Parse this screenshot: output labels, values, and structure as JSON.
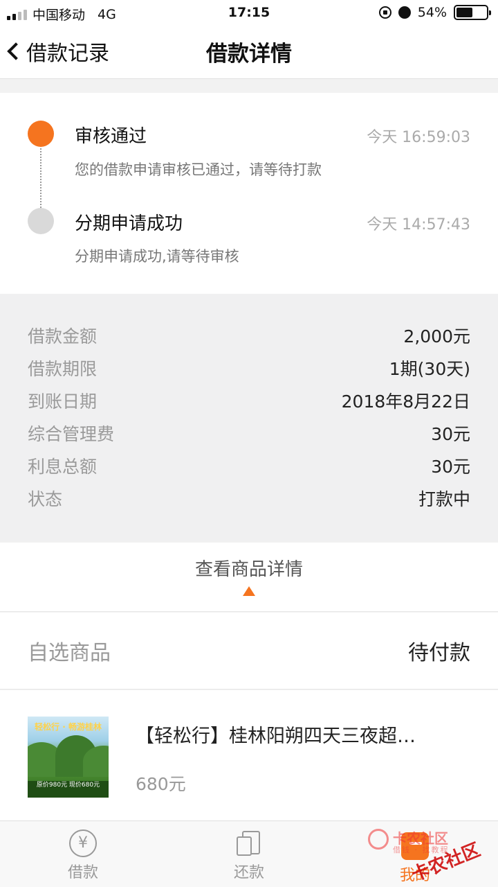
{
  "status_bar": {
    "carrier": "中国移动",
    "network": "4G",
    "time": "17:15",
    "battery": "54%",
    "battery_level": 0.54
  },
  "nav": {
    "back_label": "借款记录",
    "title": "借款详情"
  },
  "timeline": [
    {
      "title": "审核通过",
      "time": "今天 16:59:03",
      "desc": "您的借款申请审核已通过，请等待打款",
      "state": "active"
    },
    {
      "title": "分期申请成功",
      "time": "今天 14:57:43",
      "desc": "分期申请成功,请等待审核",
      "state": "inactive"
    }
  ],
  "details": [
    {
      "label": "借款金额",
      "value": "2,000元"
    },
    {
      "label": "借款期限",
      "value": "1期(30天)"
    },
    {
      "label": "到账日期",
      "value": "2018年8月22日"
    },
    {
      "label": "综合管理费",
      "value": "30元"
    },
    {
      "label": "利息总额",
      "value": "30元"
    },
    {
      "label": "状态",
      "value": "打款中"
    }
  ],
  "view_product": {
    "label": "查看商品详情"
  },
  "product_header": {
    "label": "自选商品",
    "status": "待付款"
  },
  "product": {
    "name": "【轻松行】桂林阳朔四天三夜超…",
    "price": "680元",
    "thumb_headline": "轻松行 · 畅游桂林",
    "thumb_banner": "原价980元  现价680元"
  },
  "tabs": [
    {
      "label": "借款",
      "icon": "yen-circle-icon",
      "active": false
    },
    {
      "label": "还款",
      "icon": "repay-documents-icon",
      "active": false
    },
    {
      "label": "我的",
      "icon": "profile-icon",
      "active": true
    }
  ],
  "watermark": {
    "text": "卡农社区",
    "sub": "借钱 · 找教程",
    "text2": "卡农社区"
  },
  "colors": {
    "accent": "#f5741f",
    "inactive_dot": "#d9d9d9",
    "label_gray": "#9a9a9a"
  }
}
